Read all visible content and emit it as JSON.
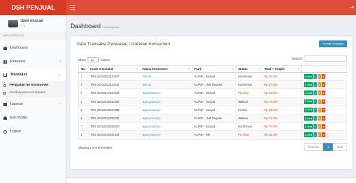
{
  "app": {
    "logo": "DSH PENJUAL",
    "top_right_icon": "sign-out-icon"
  },
  "user": {
    "name": "dewi ekasari",
    "status": "• • •"
  },
  "sidebar": {
    "header": "MENU PENJUAL",
    "items": [
      {
        "label": "Dashboard",
        "icon": "dashboard-icon"
      },
      {
        "label": "Referensi",
        "icon": "grid-icon",
        "caret": "‹"
      },
      {
        "label": "Transaksi",
        "icon": "cart-icon",
        "caret": "⌄"
      },
      {
        "label": "Laporan",
        "icon": "book-icon",
        "caret": "‹"
      },
      {
        "label": "Edit Profile",
        "icon": "user-icon"
      },
      {
        "label": "Logout",
        "icon": "power-icon"
      }
    ],
    "sub_items": [
      {
        "label": "Penjualan ke Konsumen"
      },
      {
        "label": "Pembayaran Konsumen"
      }
    ]
  },
  "page": {
    "title": "Dashboard",
    "subtitle": "Control panel"
  },
  "box": {
    "title": "Data Transaksi Penjualan / Orderan Konsumen",
    "add_button": "Tambah Penjualan",
    "show_label": "Show",
    "show_value": "10",
    "entries_label": "entries",
    "search_label": "Search:"
  },
  "table": {
    "headers": [
      "No",
      "Kode Transaksi",
      "Nama Konsumen",
      "Kurir",
      "Status",
      "Total + Ongkir"
    ],
    "rows": [
      {
        "no": "1",
        "kode": "TRX-20210622122537",
        "nama": "Stenus",
        "kurir": "KURIR - sicepat",
        "status": "Konfirmasi",
        "total": "Rp 26,000"
      },
      {
        "no": "2",
        "kode": "TRX-20210622122844",
        "nama": "Stenus",
        "kurir": "KURIR - JNE Reguler",
        "status": "Konfirmasi",
        "total": "Rp 27,000"
      },
      {
        "no": "3",
        "kode": "TRX-20210617143343",
        "nama": "agus prasetyo",
        "kurir": "KURIR - sicepat",
        "status": "Pending",
        "total": "Rp 26,000"
      },
      {
        "no": "4",
        "kode": "TRX-20210615104355",
        "nama": "agus prasetyo",
        "kurir": "KURIR - sicepat",
        "status": "Selesai",
        "total": "Rp 70,000"
      },
      {
        "no": "5",
        "kode": "TRX-20210610201939",
        "nama": "agus prasetyo",
        "kurir": "KURIR - sicepat",
        "status": "Proses",
        "total": "Rp 33,000"
      },
      {
        "no": "6",
        "kode": "TRX-20210610200322",
        "nama": "agus prasetyo",
        "kurir": "KURIR - JNE Reguler",
        "status": "Selesai",
        "total": "Rp 31,000"
      },
      {
        "no": "7",
        "kode": "TRX-20210610200320",
        "nama": "agus prasetyo",
        "kurir": "KURIR - sicepat",
        "status": "Konfirmasi",
        "total": "Rp 70,000"
      },
      {
        "no": "8",
        "kode": "TRX-20210610200138",
        "nama": "agus prasetyo",
        "kurir": "KURIR - Tiki",
        "status": "Pending",
        "total": "Rp 26,000"
      }
    ],
    "action_detail_label": "Q Detail"
  },
  "footer_info": "Showing 1 to 8 of 8 entries",
  "pagination": {
    "prev": "Previous",
    "current": "1",
    "next": "Next"
  },
  "colors": {
    "brand": "#dd4b39",
    "accent": "#3c8dbc",
    "success": "#00a65a",
    "warning": "#f39c12"
  }
}
